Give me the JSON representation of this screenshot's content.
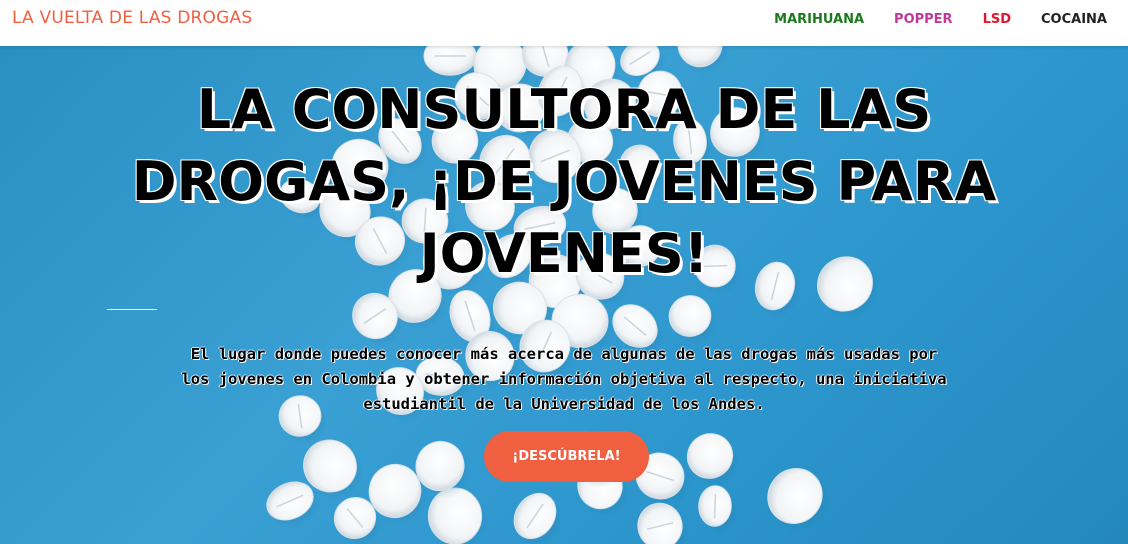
{
  "navbar": {
    "brand": "LA VUELTA DE LAS DROGAS",
    "links": [
      {
        "label": "MARIHUANA",
        "color": "#1c7a1c"
      },
      {
        "label": "POPPER",
        "color": "#c0399a"
      },
      {
        "label": "LSD",
        "color": "#e0162b"
      },
      {
        "label": "COCAINA",
        "color": "#222222"
      }
    ]
  },
  "hero": {
    "title": "LA CONSULTORA DE LAS DROGAS, ¡DE JOVENES PARA JOVENES!",
    "description": "El lugar donde puedes conocer más acerca de algunas de las drogas más usadas por los jovenes en Colombia y obtener información objetiva al respecto, una iniciativa estudiantil de la Universidad de los Andes.",
    "cta_label": "¡DESCÚBRELA!"
  },
  "colors": {
    "accent": "#f05f40",
    "background": "#2f9bd0"
  }
}
